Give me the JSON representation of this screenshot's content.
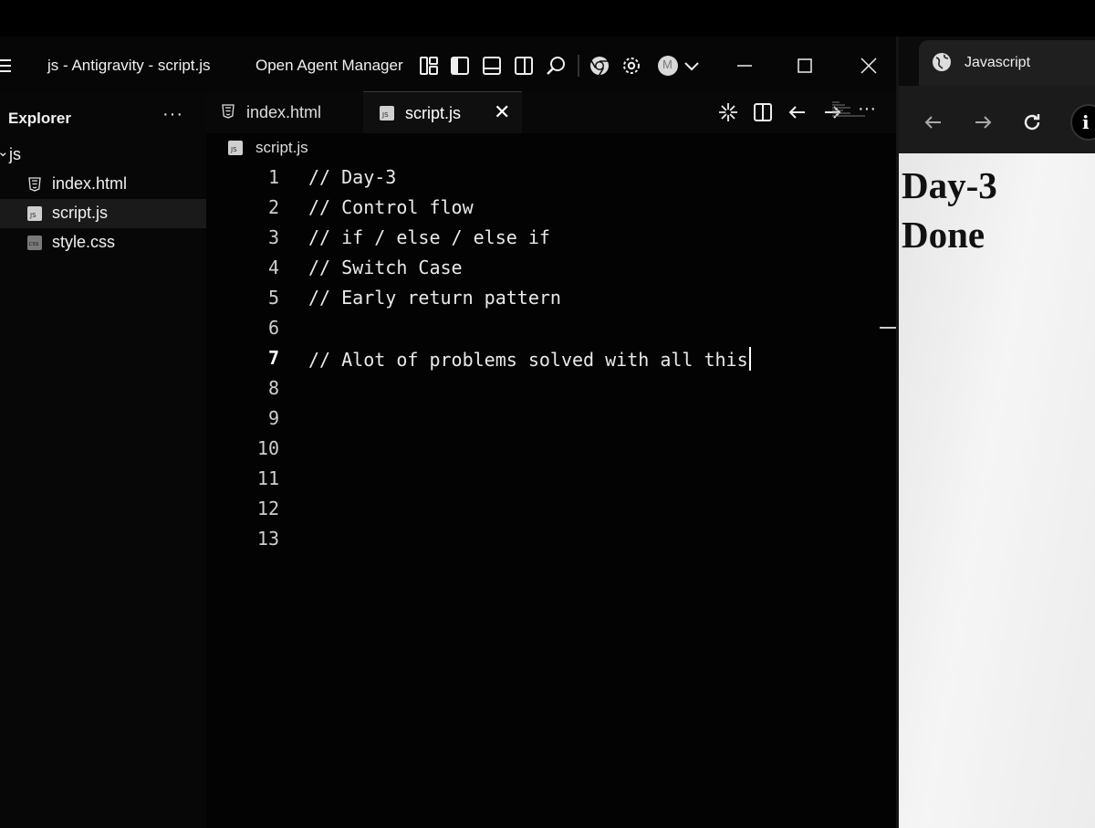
{
  "ide": {
    "window_title": "js - Antigravity - script.js",
    "menu_icon": "hamburger-icon",
    "agent_manager_label": "Open Agent Manager",
    "title_icons": [
      "layout-icon",
      "sidebar-toggle-icon",
      "panel-toggle-icon",
      "split-editor-icon",
      "search-icon",
      "chrome-icon",
      "gear-icon",
      "avatar",
      "chevron-down-icon"
    ],
    "avatar_initial": "M",
    "window_controls": [
      "minimize-icon",
      "maximize-icon",
      "close-icon"
    ]
  },
  "sidebar": {
    "title": "Explorer",
    "more_label": "···",
    "folder": {
      "name": "js",
      "expanded": true
    },
    "files": [
      {
        "name": "index.html",
        "icon": "html-file-icon",
        "active": false
      },
      {
        "name": "script.js",
        "icon": "js-file-icon",
        "active": true
      },
      {
        "name": "style.css",
        "icon": "css-file-icon",
        "active": false
      }
    ]
  },
  "editor": {
    "tabs": [
      {
        "label": "index.html",
        "icon": "html-file-icon",
        "active": false
      },
      {
        "label": "script.js",
        "icon": "js-file-icon",
        "active": true
      }
    ],
    "tab_close_label": "✕",
    "actions": [
      "sparkle-icon",
      "split-editor-icon",
      "arrow-left-icon",
      "arrow-right-icon",
      "more-icon"
    ],
    "more_label": "···",
    "breadcrumb": "script.js",
    "current_line": 7,
    "lines": [
      {
        "n": "1",
        "text": "// Day-3"
      },
      {
        "n": "2",
        "text": "// Control flow"
      },
      {
        "n": "3",
        "text": "// if / else / else if"
      },
      {
        "n": "4",
        "text": "// Switch Case"
      },
      {
        "n": "5",
        "text": "// Early return pattern"
      },
      {
        "n": "6",
        "text": ""
      },
      {
        "n": "7",
        "text": "// Alot of problems solved with all this"
      },
      {
        "n": "8",
        "text": ""
      },
      {
        "n": "9",
        "text": ""
      },
      {
        "n": "10",
        "text": ""
      },
      {
        "n": "11",
        "text": ""
      },
      {
        "n": "12",
        "text": ""
      },
      {
        "n": "13",
        "text": ""
      }
    ]
  },
  "browser": {
    "tab_title": "Javascript",
    "tab_icon": "globe-icon",
    "nav_icons": [
      "back-icon",
      "forward-icon",
      "reload-icon",
      "site-info-icon"
    ],
    "site_info_label": "i",
    "page_heading": "Day-3 Done"
  }
}
